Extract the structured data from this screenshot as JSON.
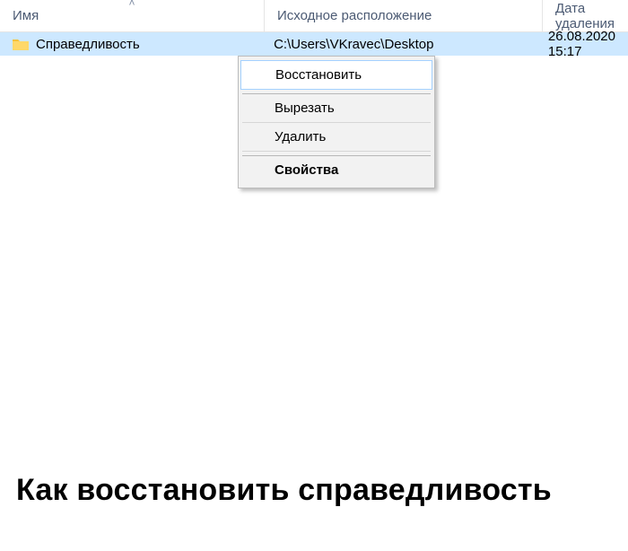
{
  "columns": {
    "name": "Имя",
    "origin": "Исходное расположение",
    "date": "Дата удаления"
  },
  "row": {
    "name": "Справедливость",
    "origin": "C:\\Users\\VKravec\\Desktop",
    "date": "26.08.2020 15:17"
  },
  "context_menu": {
    "restore": "Восстановить",
    "cut": "Вырезать",
    "delete": "Удалить",
    "properties": "Свойства"
  },
  "caption": "Как восстановить справедливость"
}
